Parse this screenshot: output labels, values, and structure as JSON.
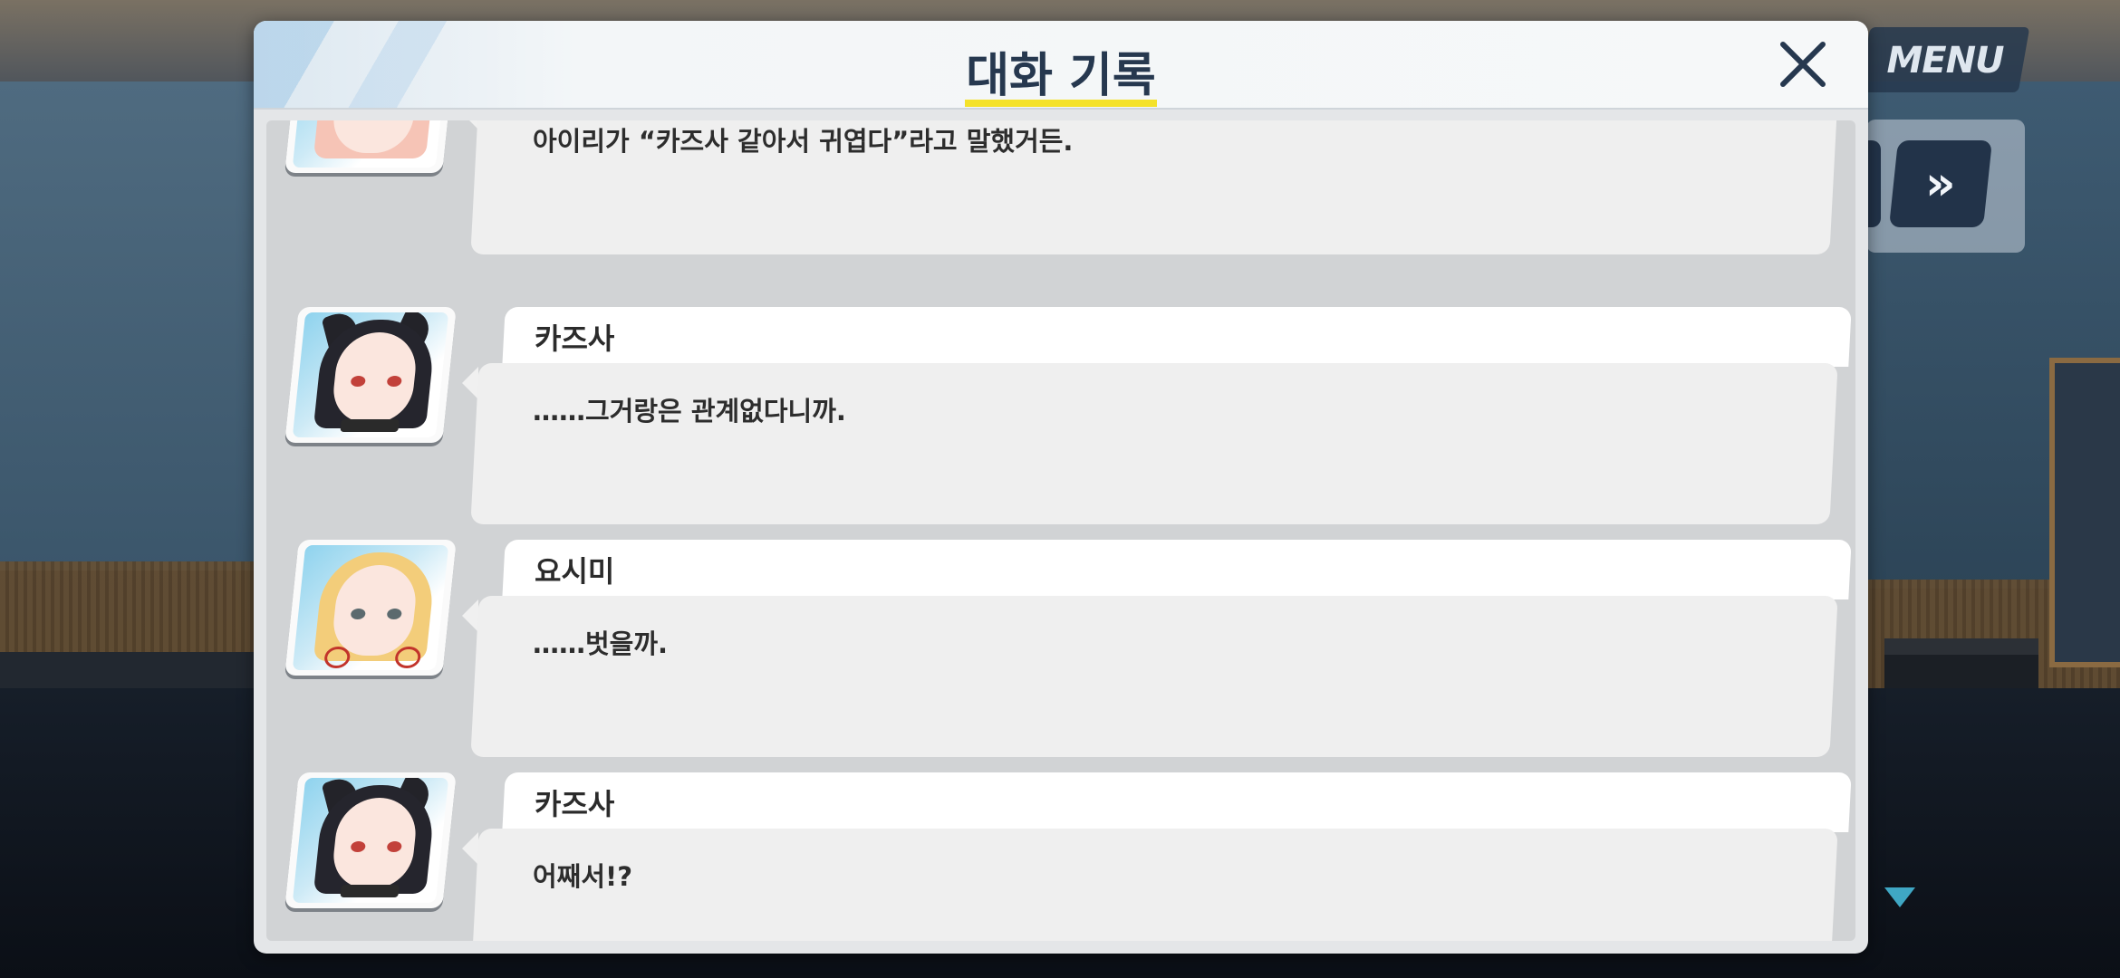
{
  "modal": {
    "title": "대화 기록",
    "close_icon": "close-icon"
  },
  "menu": {
    "label": "MENU",
    "skip_icon": "fast-forward-icon"
  },
  "entries": [
    {
      "speaker": "",
      "text": "아이리가 “카즈사 같아서 귀엽다”라고 말했거든.",
      "portrait": "pink-hair-girl"
    },
    {
      "speaker": "카즈사",
      "text": "……그거랑은 관계없다니까.",
      "portrait": "black-hair-cat-ears-girl"
    },
    {
      "speaker": "요시미",
      "text": "……벗을까.",
      "portrait": "blonde-hair-girl"
    },
    {
      "speaker": "카즈사",
      "text": "어째서!?",
      "portrait": "black-hair-cat-ears-girl"
    }
  ],
  "colors": {
    "title_underline": "#f4e22a",
    "title": "#26384f",
    "menu_bg": "#26384d"
  }
}
